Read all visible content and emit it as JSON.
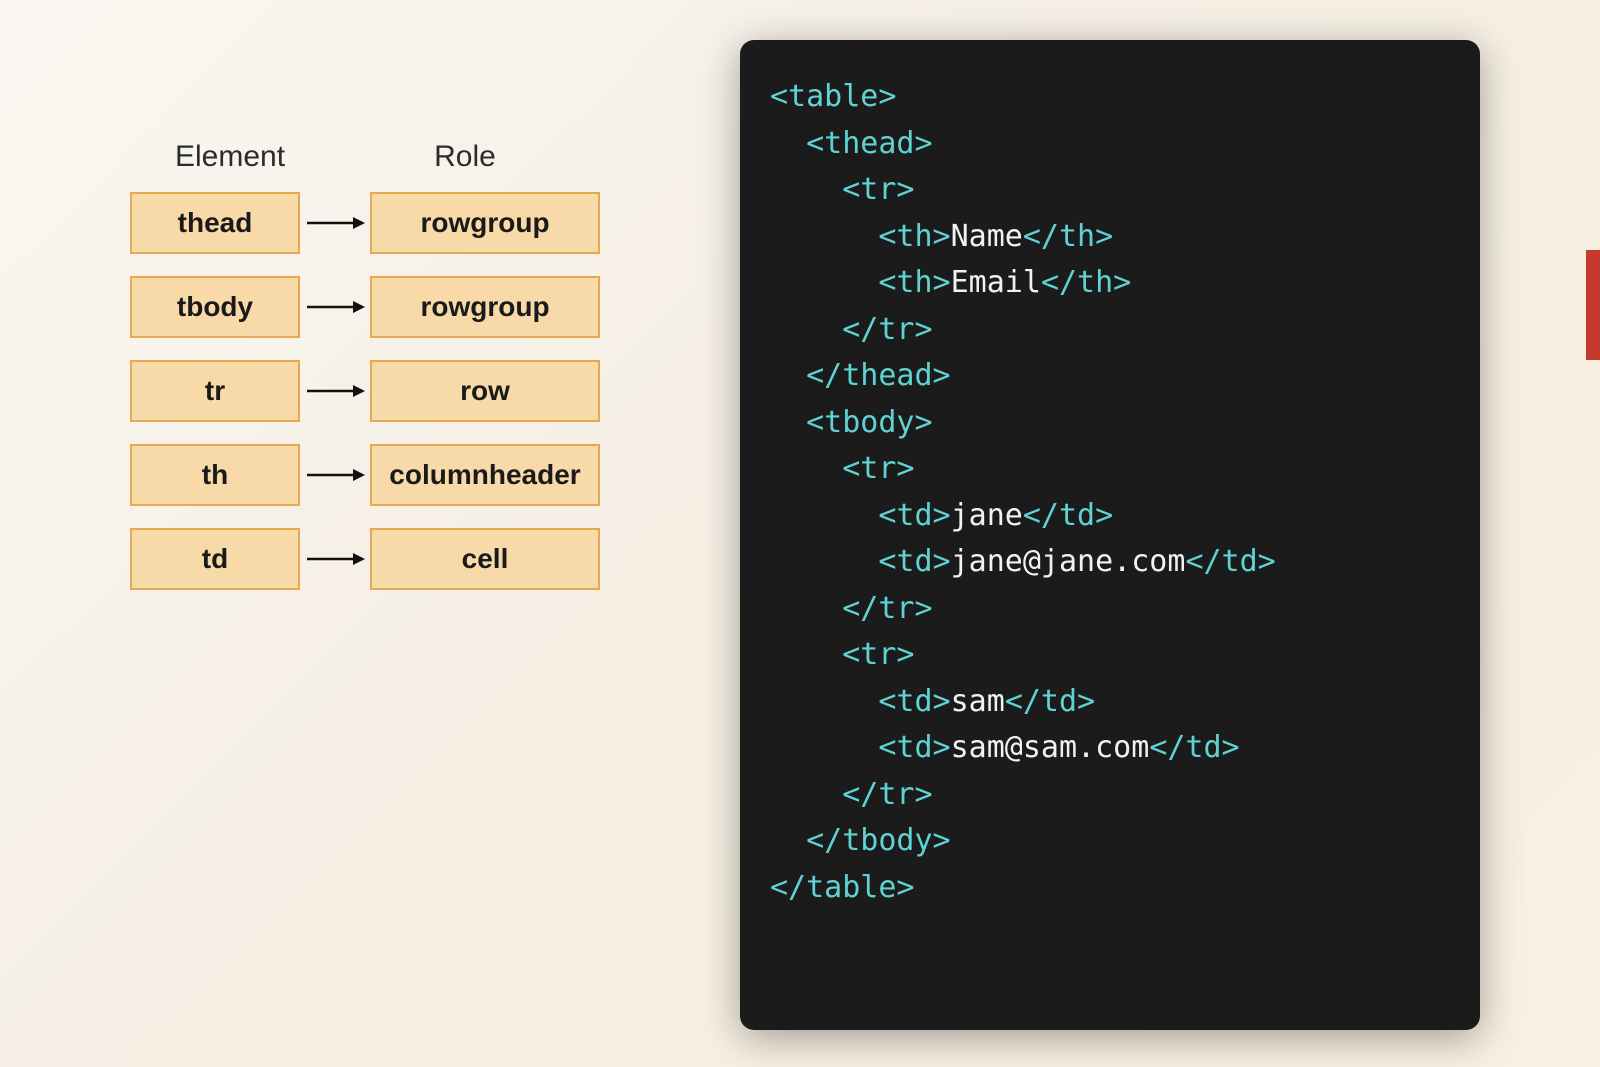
{
  "diagram": {
    "header_element": "Element",
    "header_role": "Role",
    "rows": [
      {
        "element": "thead",
        "role": "rowgroup"
      },
      {
        "element": "tbody",
        "role": "rowgroup"
      },
      {
        "element": "tr",
        "role": "row"
      },
      {
        "element": "th",
        "role": "columnheader"
      },
      {
        "element": "td",
        "role": "cell"
      }
    ]
  },
  "code": {
    "lines": [
      {
        "indent": 0,
        "parts": [
          {
            "k": "tag",
            "t": "<table>"
          }
        ]
      },
      {
        "indent": 1,
        "parts": [
          {
            "k": "tag",
            "t": "<thead>"
          }
        ]
      },
      {
        "indent": 2,
        "parts": [
          {
            "k": "tag",
            "t": "<tr>"
          }
        ]
      },
      {
        "indent": 3,
        "parts": [
          {
            "k": "tag",
            "t": "<th>"
          },
          {
            "k": "text",
            "t": "Name"
          },
          {
            "k": "tag",
            "t": "</th>"
          }
        ]
      },
      {
        "indent": 3,
        "parts": [
          {
            "k": "tag",
            "t": "<th>"
          },
          {
            "k": "text",
            "t": "Email"
          },
          {
            "k": "tag",
            "t": "</th>"
          }
        ]
      },
      {
        "indent": 2,
        "parts": [
          {
            "k": "tag",
            "t": "</tr>"
          }
        ]
      },
      {
        "indent": 1,
        "parts": [
          {
            "k": "tag",
            "t": "</thead>"
          }
        ]
      },
      {
        "indent": 1,
        "parts": [
          {
            "k": "tag",
            "t": "<tbody>"
          }
        ]
      },
      {
        "indent": 2,
        "parts": [
          {
            "k": "tag",
            "t": "<tr>"
          }
        ]
      },
      {
        "indent": 3,
        "parts": [
          {
            "k": "tag",
            "t": "<td>"
          },
          {
            "k": "text",
            "t": "jane"
          },
          {
            "k": "tag",
            "t": "</td>"
          }
        ]
      },
      {
        "indent": 3,
        "parts": [
          {
            "k": "tag",
            "t": "<td>"
          },
          {
            "k": "text",
            "t": "jane@jane.com"
          },
          {
            "k": "tag",
            "t": "</td>"
          }
        ]
      },
      {
        "indent": 2,
        "parts": [
          {
            "k": "tag",
            "t": "</tr>"
          }
        ]
      },
      {
        "indent": 2,
        "parts": [
          {
            "k": "tag",
            "t": "<tr>"
          }
        ]
      },
      {
        "indent": 3,
        "parts": [
          {
            "k": "tag",
            "t": "<td>"
          },
          {
            "k": "text",
            "t": "sam"
          },
          {
            "k": "tag",
            "t": "</td>"
          }
        ]
      },
      {
        "indent": 3,
        "parts": [
          {
            "k": "tag",
            "t": "<td>"
          },
          {
            "k": "text",
            "t": "sam@sam.com"
          },
          {
            "k": "tag",
            "t": "</td>"
          }
        ]
      },
      {
        "indent": 2,
        "parts": [
          {
            "k": "tag",
            "t": "</tr>"
          }
        ]
      },
      {
        "indent": 1,
        "parts": [
          {
            "k": "tag",
            "t": "</tbody>"
          }
        ]
      },
      {
        "indent": 0,
        "parts": [
          {
            "k": "tag",
            "t": "</table>"
          }
        ]
      }
    ]
  }
}
